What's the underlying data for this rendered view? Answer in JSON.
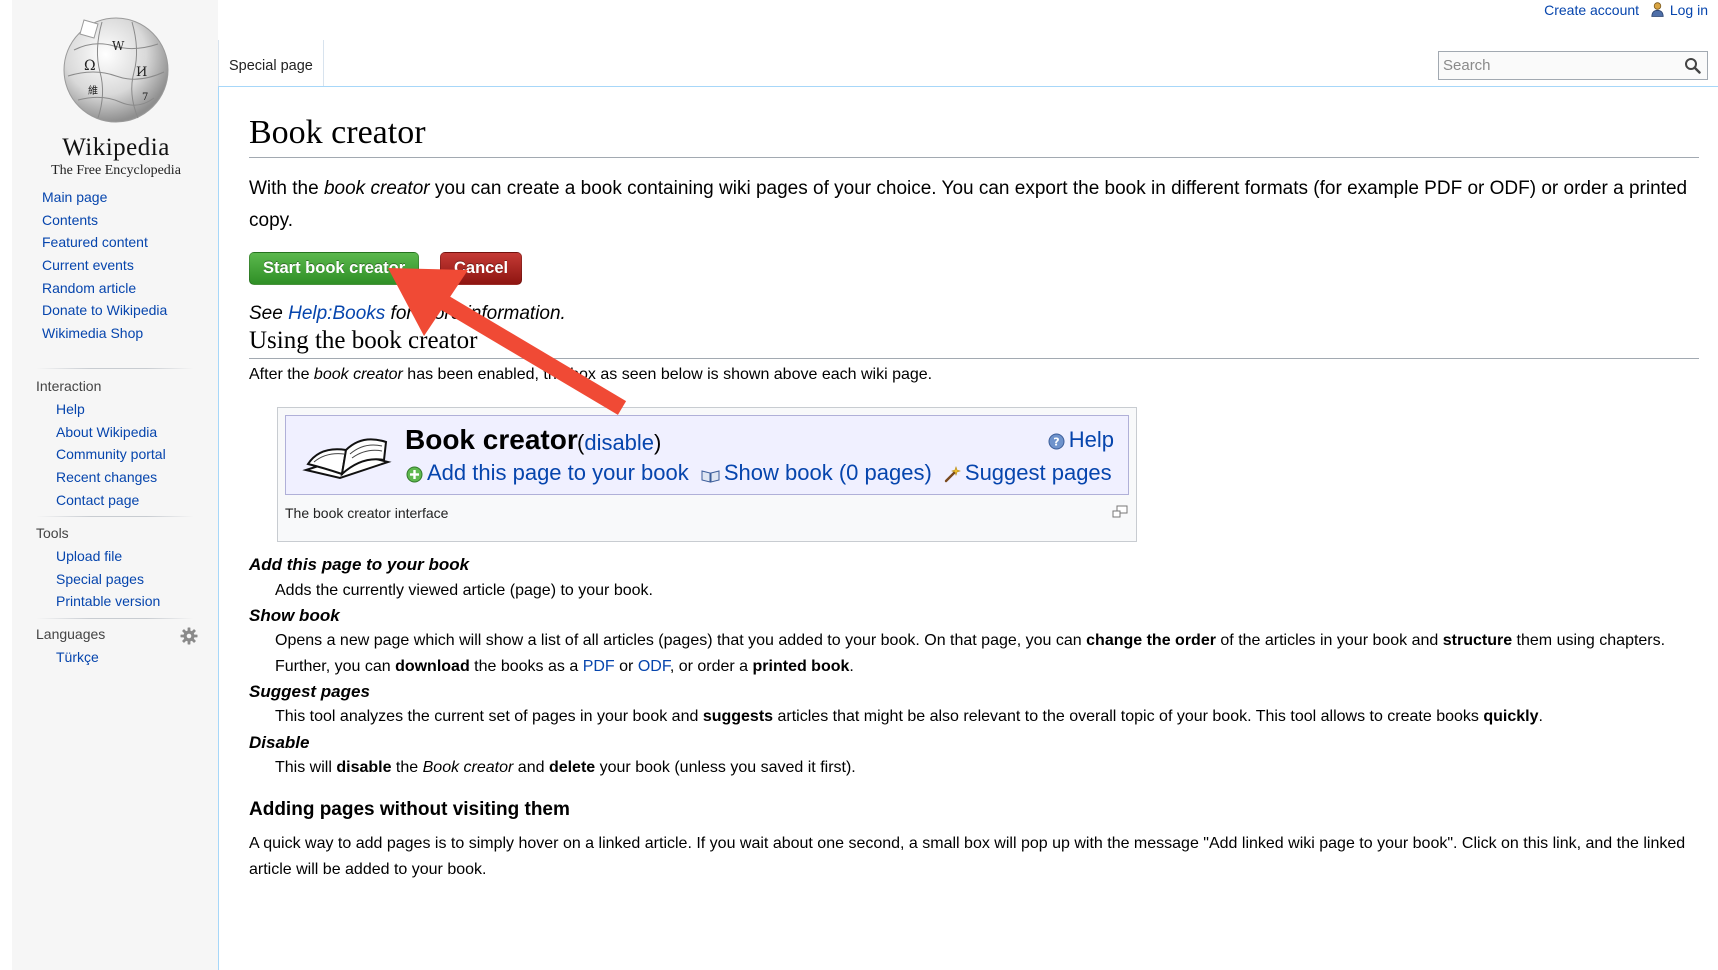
{
  "header": {
    "create_account": "Create account",
    "log_in": "Log in",
    "tab_label": "Special page",
    "search_placeholder": "Search"
  },
  "logo": {
    "wordmark": "Wikipedia",
    "tagline": "The Free Encyclopedia"
  },
  "sidebar": {
    "nav": [
      "Main page",
      "Contents",
      "Featured content",
      "Current events",
      "Random article",
      "Donate to Wikipedia",
      "Wikimedia Shop"
    ],
    "interaction": {
      "heading": "Interaction",
      "items": [
        "Help",
        "About Wikipedia",
        "Community portal",
        "Recent changes",
        "Contact page"
      ]
    },
    "tools": {
      "heading": "Tools",
      "items": [
        "Upload file",
        "Special pages",
        "Printable version"
      ]
    },
    "languages": {
      "heading": "Languages",
      "items": [
        "Türkçe"
      ]
    }
  },
  "content": {
    "title": "Book creator",
    "intro_1": "With the ",
    "intro_em": "book creator",
    "intro_2": " you can create a book containing wiki pages of your choice. You can export the book in different formats (for example PDF or ODF) or order a printed copy.",
    "start_button": "Start book creator",
    "cancel_button": "Cancel",
    "see_1": "See ",
    "see_link": "Help:Books",
    "see_2": " for more information.",
    "section_using": "Using the book creator",
    "after_1": "After the ",
    "after_em": "book creator",
    "after_2": " has been enabled, the box as seen below is shown above each wiki page.",
    "thumb": {
      "title": "Book creator",
      "disable_open": "(",
      "disable_link": "disable",
      "disable_close": ")",
      "help": "Help",
      "add_page": "Add this page to your book",
      "show_book": "Show book (0 pages)",
      "suggest": "Suggest pages",
      "caption": "The book creator interface"
    },
    "definitions": [
      {
        "term": "Add this page to your book",
        "desc": "Adds the currently viewed article (page) to your book."
      },
      {
        "term": "Show book",
        "p1": "Opens a new page which will show a list of all articles (pages) that you added to your book. On that page, you can ",
        "b1": "change the order",
        "p2": " of the articles in your book and ",
        "b2": "structure",
        "p3": " them using chapters. Further, you can ",
        "b3": "download",
        "p4": " the books as a ",
        "l1": "PDF",
        "p5": " or ",
        "l2": "ODF",
        "p6": ", or order a ",
        "b4": "printed book",
        "p7": "."
      },
      {
        "term": "Suggest pages",
        "p1": "This tool analyzes the current set of pages in your book and ",
        "b1": "suggests",
        "p2": " articles that might be also relevant to the overall topic of your book. This tool allows to create books ",
        "b2": "quickly",
        "p3": "."
      },
      {
        "term": "Disable",
        "p1": "This will ",
        "b1": "disable",
        "p2": " the ",
        "e1": "Book creator",
        "p3": " and ",
        "b2": "delete",
        "p4": " your book (unless you saved it first)."
      }
    ],
    "section_adding": "Adding pages without visiting them",
    "quick_way": "A quick way to add pages is to simply hover on a linked article. If you wait about one second, a small box will pop up with the message \"Add linked wiki page to your book\". Click on this link, and the linked article will be added to your book."
  },
  "colors": {
    "link": "#0645ad",
    "start_button": "#3a9d2f",
    "cancel_button": "#a3201b",
    "annotation_arrow": "#f04a35"
  },
  "icons": [
    "wikipedia-globe-icon",
    "user-icon",
    "search-icon",
    "gear-icon",
    "open-book-icon",
    "help-icon",
    "add-icon",
    "book-icon",
    "wand-icon",
    "magnify-icon",
    "annotation-arrow"
  ]
}
